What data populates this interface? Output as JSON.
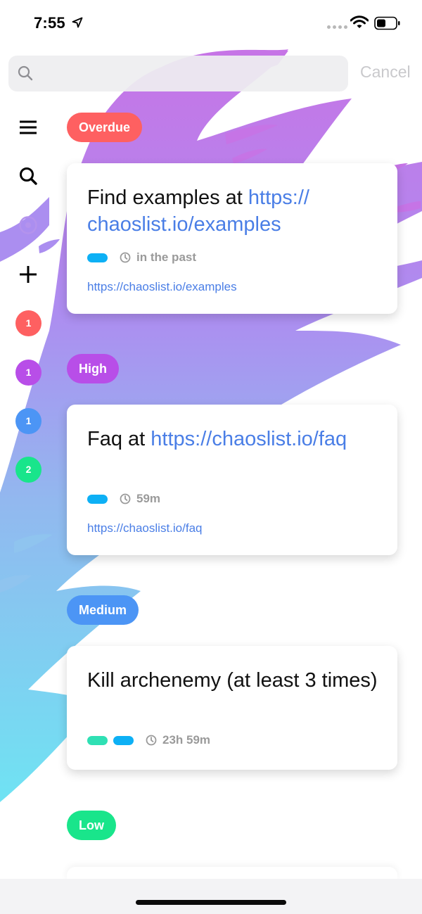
{
  "status_bar": {
    "time": "7:55",
    "icons": [
      "location-arrow-icon",
      "signal-dots-icon",
      "wifi-icon",
      "battery-icon"
    ]
  },
  "search": {
    "placeholder": "",
    "value": "",
    "cancel_label": "Cancel"
  },
  "sidebar": {
    "icons": [
      "menu-icon",
      "search-icon",
      "target-icon",
      "plus-icon"
    ],
    "badges": [
      {
        "count": "1",
        "color": "#fe6061",
        "priority": "Overdue"
      },
      {
        "count": "1",
        "color": "#b84ee8",
        "priority": "High"
      },
      {
        "count": "1",
        "color": "#4c95f5",
        "priority": "Medium"
      },
      {
        "count": "2",
        "color": "#19e58b",
        "priority": "Low"
      }
    ]
  },
  "sections": [
    {
      "label": "Overdue",
      "color": "#fe6061",
      "tasks": [
        {
          "title_text": "Find examples at ",
          "title_link": "https://​chaoslist.io/examples",
          "tags": [
            "#0db0f5"
          ],
          "due": "in the past",
          "url": "https://chaoslist.io/examples"
        }
      ]
    },
    {
      "label": "High",
      "color": "#b84ee8",
      "tasks": [
        {
          "title_text": "Faq at ",
          "title_link": "https://chaoslist.io/​faq",
          "tags": [
            "#0db0f5"
          ],
          "due": "59m",
          "url": "https://chaoslist.io/faq"
        }
      ]
    },
    {
      "label": "Medium",
      "color": "#4c95f5",
      "tasks": [
        {
          "title_text": "Kill archenemy (at least 3 times)",
          "title_link": "",
          "tags": [
            "#2fe0b4",
            "#0db0f5"
          ],
          "due": "23h 59m",
          "url": ""
        }
      ]
    },
    {
      "label": "Low",
      "color": "#19e58b",
      "tasks": []
    }
  ],
  "colors": {
    "link": "#4a7ee6",
    "meta_gray": "#9a9a9a",
    "cancel_gray": "#c9c9cc"
  }
}
